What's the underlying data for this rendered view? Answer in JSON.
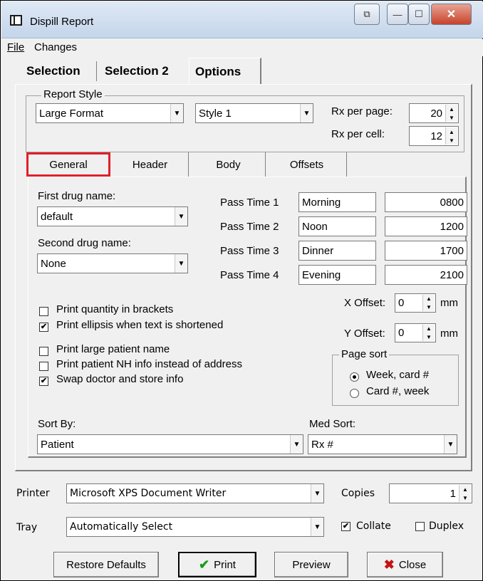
{
  "window": {
    "title": "Dispill Report",
    "restore_glyph": "⧉",
    "min_glyph": "—",
    "max_glyph": "☐",
    "close_glyph": "✕"
  },
  "menu": {
    "file": "File",
    "changes": "Changes"
  },
  "tabs": [
    "Selection",
    "Selection 2",
    "Options"
  ],
  "report_style": {
    "legend": "Report Style",
    "format": "Large Format",
    "style": "Style 1",
    "rx_per_page_label": "Rx per page:",
    "rx_per_page": "20",
    "rx_per_cell_label": "Rx per cell:",
    "rx_per_cell": "12"
  },
  "subtabs": [
    "General",
    "Header",
    "Body",
    "Offsets"
  ],
  "general": {
    "first_drug_label": "First drug name:",
    "first_drug": "default",
    "second_drug_label": "Second drug name:",
    "second_drug": "None",
    "pass_times": [
      {
        "label": "Pass Time 1",
        "name": "Morning",
        "time": "0800"
      },
      {
        "label": "Pass Time 2",
        "name": "Noon",
        "time": "1200"
      },
      {
        "label": "Pass Time 3",
        "name": "Dinner",
        "time": "1700"
      },
      {
        "label": "Pass Time 4",
        "name": "Evening",
        "time": "2100"
      }
    ],
    "x_offset_label": "X Offset:",
    "x_offset": "0",
    "y_offset_label": "Y Offset:",
    "y_offset": "0",
    "unit": "mm",
    "checkboxes": [
      {
        "label": "Print quantity in brackets",
        "checked": false
      },
      {
        "label": "Print ellipsis when text is shortened",
        "checked": true
      },
      {
        "label": "Print large patient name",
        "checked": false
      },
      {
        "label": "Print patient NH info instead of address",
        "checked": false
      },
      {
        "label": "Swap doctor and store info",
        "checked": true
      }
    ],
    "page_sort_legend": "Page sort",
    "page_sort_options": [
      {
        "label": "Week, card #",
        "selected": true
      },
      {
        "label": "Card #, week",
        "selected": false
      }
    ],
    "sort_by_label": "Sort By:",
    "sort_by": "Patient",
    "med_sort_label": "Med Sort:",
    "med_sort": "Rx #"
  },
  "printer": {
    "printer_label": "Printer",
    "printer": "Microsoft XPS Document Writer",
    "copies_label": "Copies",
    "copies": "1",
    "tray_label": "Tray",
    "tray": "Automatically Select",
    "collate_label": "Collate",
    "collate": true,
    "duplex_label": "Duplex",
    "duplex": false
  },
  "buttons": {
    "restore": "Restore Defaults",
    "print": "Print",
    "preview": "Preview",
    "close": "Close"
  },
  "colors": {
    "highlight_border": "#e0202a",
    "check_icon": "#1a9b1a",
    "close_icon": "#c41212"
  }
}
